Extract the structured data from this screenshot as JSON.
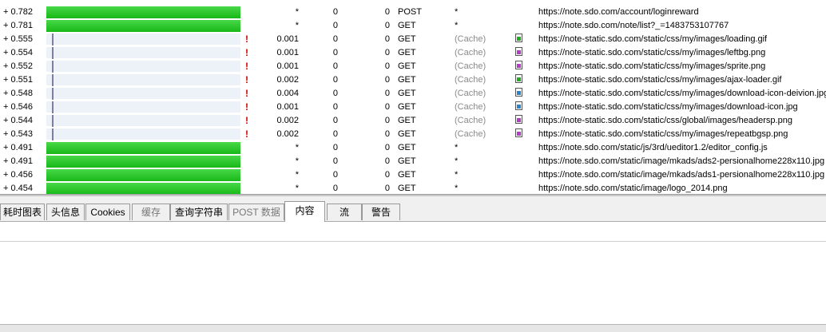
{
  "requests": [
    {
      "time": "+ 0.782",
      "bar": "full",
      "warn": "",
      "size": "*",
      "a": "0",
      "b": "0",
      "method": "POST",
      "status": "*",
      "status_kind": "",
      "icon": "",
      "url": "https://note.sdo.com/account/loginreward"
    },
    {
      "time": "+ 0.781",
      "bar": "full",
      "warn": "",
      "size": "*",
      "a": "0",
      "b": "0",
      "method": "GET",
      "status": "*",
      "status_kind": "",
      "icon": "",
      "url": "https://note.sdo.com/note/list?_=1483753107767"
    },
    {
      "time": "+ 0.555",
      "bar": "cache",
      "warn": "!",
      "size": "0.001",
      "a": "0",
      "b": "0",
      "method": "GET",
      "status": "(Cache)",
      "status_kind": "cache",
      "icon": "gif-file-icon",
      "url": "https://note-static.sdo.com/static/css/my/images/loading.gif"
    },
    {
      "time": "+ 0.554",
      "bar": "cache",
      "warn": "!",
      "size": "0.001",
      "a": "0",
      "b": "0",
      "method": "GET",
      "status": "(Cache)",
      "status_kind": "cache",
      "icon": "png-file-icon",
      "url": "https://note-static.sdo.com/static/css/my/images/leftbg.png"
    },
    {
      "time": "+ 0.552",
      "bar": "cache",
      "warn": "!",
      "size": "0.001",
      "a": "0",
      "b": "0",
      "method": "GET",
      "status": "(Cache)",
      "status_kind": "cache",
      "icon": "png-file-icon",
      "url": "https://note-static.sdo.com/static/css/my/images/sprite.png"
    },
    {
      "time": "+ 0.551",
      "bar": "cache",
      "warn": "!",
      "size": "0.002",
      "a": "0",
      "b": "0",
      "method": "GET",
      "status": "(Cache)",
      "status_kind": "cache",
      "icon": "gif-file-icon",
      "url": "https://note-static.sdo.com/static/css/my/images/ajax-loader.gif"
    },
    {
      "time": "+ 0.548",
      "bar": "cache",
      "warn": "!",
      "size": "0.004",
      "a": "0",
      "b": "0",
      "method": "GET",
      "status": "(Cache)",
      "status_kind": "cache",
      "icon": "jpg-file-icon",
      "url": "https://note-static.sdo.com/static/css/my/images/download-icon-deivion.jpg"
    },
    {
      "time": "+ 0.546",
      "bar": "cache",
      "warn": "!",
      "size": "0.001",
      "a": "0",
      "b": "0",
      "method": "GET",
      "status": "(Cache)",
      "status_kind": "cache",
      "icon": "jpg-file-icon",
      "url": "https://note-static.sdo.com/static/css/my/images/download-icon.jpg"
    },
    {
      "time": "+ 0.544",
      "bar": "cache",
      "warn": "!",
      "size": "0.002",
      "a": "0",
      "b": "0",
      "method": "GET",
      "status": "(Cache)",
      "status_kind": "cache",
      "icon": "png-file-icon",
      "url": "https://note-static.sdo.com/static/css/global/images/headersp.png"
    },
    {
      "time": "+ 0.543",
      "bar": "cache",
      "warn": "!",
      "size": "0.002",
      "a": "0",
      "b": "0",
      "method": "GET",
      "status": "(Cache)",
      "status_kind": "cache",
      "icon": "png-file-icon",
      "url": "https://note-static.sdo.com/static/css/my/images/repeatbgsp.png"
    },
    {
      "time": "+ 0.491",
      "bar": "full",
      "warn": "",
      "size": "*",
      "a": "0",
      "b": "0",
      "method": "GET",
      "status": "*",
      "status_kind": "",
      "icon": "",
      "url": "https://note.sdo.com/static/js/3rd/ueditor1.2/editor_config.js"
    },
    {
      "time": "+ 0.491",
      "bar": "full",
      "warn": "",
      "size": "*",
      "a": "0",
      "b": "0",
      "method": "GET",
      "status": "*",
      "status_kind": "",
      "icon": "",
      "url": "https://note.sdo.com/static/image/mkads/ads2-persionalhome228x110.jpg"
    },
    {
      "time": "+ 0.456",
      "bar": "full",
      "warn": "",
      "size": "*",
      "a": "0",
      "b": "0",
      "method": "GET",
      "status": "*",
      "status_kind": "",
      "icon": "",
      "url": "https://note.sdo.com/static/image/mkads/ads1-persionalhome228x110.jpg"
    },
    {
      "time": "+ 0.454",
      "bar": "full",
      "warn": "",
      "size": "*",
      "a": "0",
      "b": "0",
      "method": "GET",
      "status": "*",
      "status_kind": "",
      "icon": "",
      "url": "https://note.sdo.com/static/image/logo_2014.png"
    }
  ],
  "tabs": [
    {
      "label": "耗时图表",
      "state": "normal"
    },
    {
      "label": "头信息",
      "state": "normal"
    },
    {
      "label": "Cookies",
      "state": "normal"
    },
    {
      "label": "缓存",
      "state": "dim"
    },
    {
      "label": "查询字符串",
      "state": "normal"
    },
    {
      "label": "POST 数据",
      "state": "dim"
    },
    {
      "label": "内容",
      "state": "active"
    },
    {
      "label": "流",
      "state": "normal"
    },
    {
      "label": "警告",
      "state": "normal"
    }
  ],
  "icon_colors": {
    "gif-file-icon": "#22aa22",
    "png-file-icon": "#b23cc6",
    "jpg-file-icon": "#2c82c9"
  }
}
